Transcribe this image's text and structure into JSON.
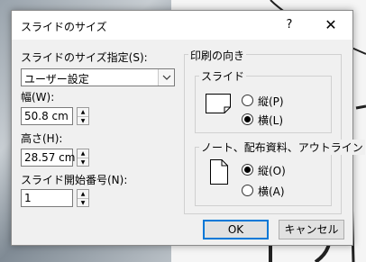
{
  "dialog": {
    "title": "スライドのサイズ",
    "help_label": "?",
    "close_label": "✕"
  },
  "size_spec": {
    "label": "スライドのサイズ指定(S):",
    "value": "ユーザー設定"
  },
  "width": {
    "label": "幅(W):",
    "value": "50.8 cm"
  },
  "height": {
    "label": "高さ(H):",
    "value": "28.57 cm"
  },
  "start_number": {
    "label": "スライド開始番号(N):",
    "value": "1"
  },
  "orientation": {
    "group_label": "印刷の向き",
    "slides": {
      "label": "スライド",
      "portrait_label": "縦(P)",
      "landscape_label": "横(L)",
      "selected": "landscape"
    },
    "notes": {
      "label": "ノート、配布資料、アウトライン",
      "portrait_label": "縦(O)",
      "landscape_label": "横(A)",
      "selected": "portrait"
    }
  },
  "buttons": {
    "ok": "OK",
    "cancel": "キャンセル"
  },
  "icons": {
    "close": "close-icon",
    "dropdown": "chevron-down-icon",
    "spin_up": "triangle-up-icon",
    "spin_down": "triangle-down-icon",
    "landscape_page": "landscape-page-icon",
    "portrait_page": "portrait-page-icon"
  },
  "colors": {
    "accent": "#0078d7",
    "dialog_bg": "#f0f0f0"
  }
}
